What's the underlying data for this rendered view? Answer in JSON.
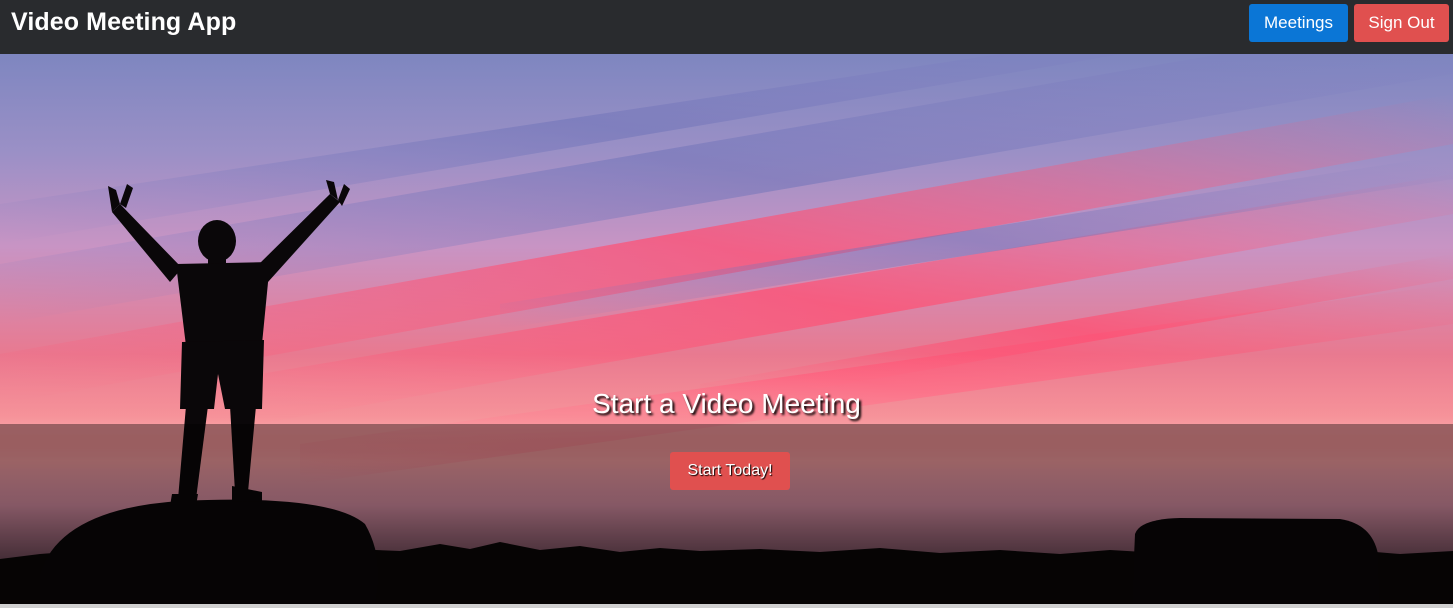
{
  "header": {
    "app_title": "Video Meeting App",
    "meetings_label": "Meetings",
    "sign_out_label": "Sign Out"
  },
  "hero": {
    "title": "Start a Video Meeting",
    "cta_label": "Start Today!"
  },
  "colors": {
    "navbar": "#292b2e",
    "primary_button": "#0b76d6",
    "danger_button": "#e0504f",
    "text": "#ffffff"
  }
}
